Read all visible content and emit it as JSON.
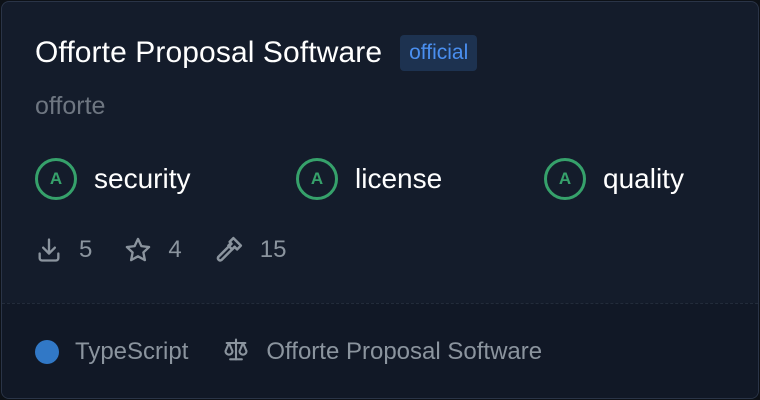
{
  "package": {
    "title": "Offorte Proposal Software",
    "badge": "official",
    "publisher": "offorte"
  },
  "scores": [
    {
      "grade": "A",
      "label": "security"
    },
    {
      "grade": "A",
      "label": "license"
    },
    {
      "grade": "A",
      "label": "quality"
    }
  ],
  "stats": {
    "downloads": "5",
    "stars": "4",
    "tools": "15"
  },
  "footer": {
    "language": "TypeScript",
    "language_color": "#3178c6",
    "license": "Offorte Proposal Software"
  },
  "colors": {
    "score_green": "#36a16b",
    "badge_blue": "#4a8ff0",
    "card_bg": "#141c2b"
  },
  "icons": {
    "downloads": "download-icon",
    "stars": "star-icon",
    "tools": "hammer-icon",
    "license": "scale-icon"
  }
}
